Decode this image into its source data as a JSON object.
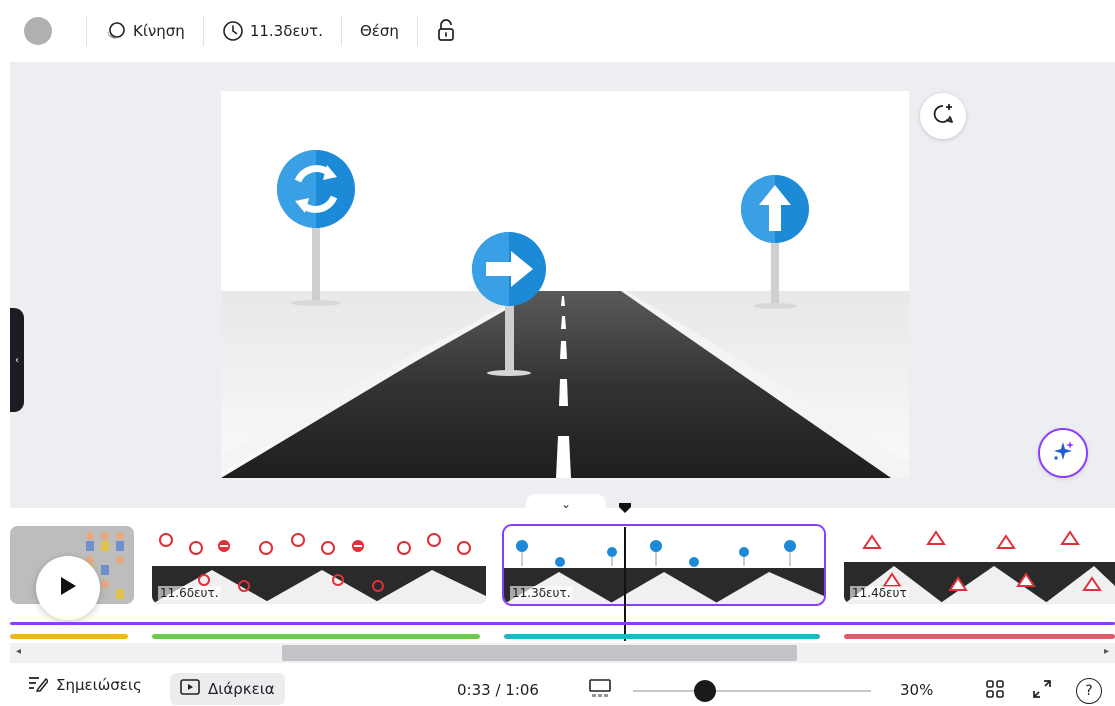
{
  "toolbar": {
    "animation_label": "Κίνηση",
    "duration_label": "11.3δευτ.",
    "position_label": "Θέση"
  },
  "clips": [
    {
      "label": ""
    },
    {
      "label": "11.6δευτ."
    },
    {
      "label": "11.3δευτ."
    },
    {
      "label": "11.4δευτ"
    }
  ],
  "colors": {
    "accent": "#8b3dff",
    "bar_yellow": "#f0b429",
    "bar_green": "#6bcb4b",
    "bar_teal": "#23b5c7",
    "bar_red": "#e05a6a",
    "sign_blue": "#1c8ad6"
  },
  "bottombar": {
    "notes_label": "Σημειώσεις",
    "duration_label": "Διάρκεια",
    "time": "0:33 / 1:06",
    "zoom": "30%",
    "zoom_fraction": 0.3,
    "help_label": "?"
  }
}
